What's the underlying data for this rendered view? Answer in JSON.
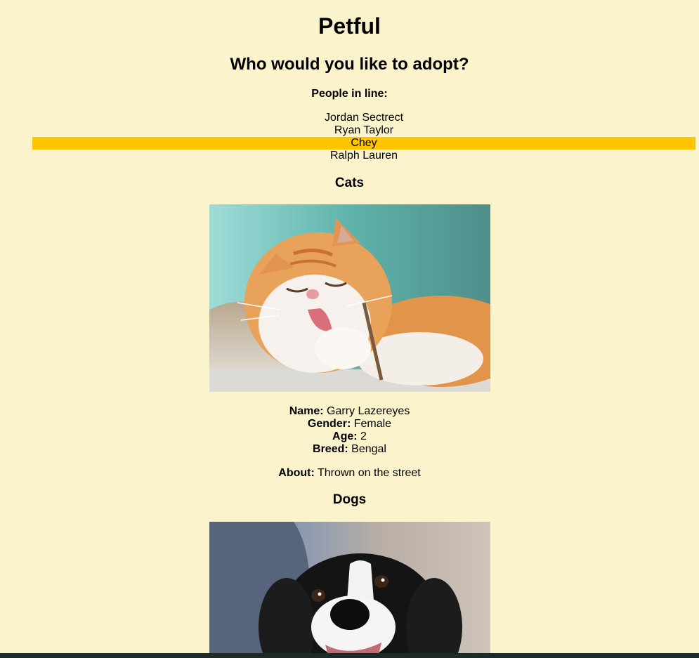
{
  "app": {
    "title": "Petful",
    "subtitle": "Who would you like to adopt?"
  },
  "queue": {
    "heading": "People in line:",
    "people": [
      "Jordan Sectrect",
      "Ryan Taylor",
      "Chey",
      "Ralph Lauren"
    ],
    "active_person": "Chey",
    "highlight_color": "#fdc500"
  },
  "cats": {
    "heading": "Cats",
    "photo_icon": "orange-white-cat-photo",
    "name_label": "Name:",
    "name": "Garry Lazereyes",
    "gender_label": "Gender:",
    "gender": "Female",
    "age_label": "Age:",
    "age": "2",
    "breed_label": "Breed:",
    "breed": "Bengal",
    "about_label": "About:",
    "about": "Thrown on the street"
  },
  "dogs": {
    "heading": "Dogs",
    "photo_icon": "black-white-dog-photo"
  },
  "colors": {
    "background": "#fbf3cb",
    "highlight": "#fdc500"
  }
}
